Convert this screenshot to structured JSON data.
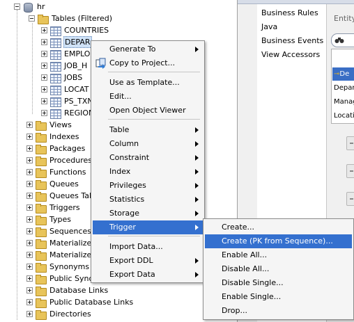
{
  "tree": {
    "root": "hr",
    "tables_folder": "Tables (Filtered)",
    "tables": [
      "COUNTRIES",
      "DEPAR",
      "EMPLO",
      "JOB_H",
      "JOBS",
      "LOCAT",
      "PS_TXN",
      "REGION"
    ],
    "folders": [
      "Views",
      "Indexes",
      "Packages",
      "Procedures",
      "Functions",
      "Queues",
      "Queues Tal",
      "Triggers",
      "Types",
      "Sequences",
      "Materialize",
      "Materialize",
      "Synonyms",
      "Public Syno",
      "Database Links",
      "Public Database Links",
      "Directories"
    ]
  },
  "right_panel": {
    "nav_items": [
      "Business Rules",
      "Java",
      "Business Events",
      "View Accessors"
    ],
    "entity_label": "Entity",
    "list_items": [
      "De",
      "Depart",
      "Manag",
      "Locatio"
    ]
  },
  "context_menu": {
    "items": [
      {
        "label": "Generate To",
        "submenu": true
      },
      {
        "label": "Copy to Project...",
        "icon": "copy-icon"
      },
      {
        "label": "Use as Template..."
      },
      {
        "label": "Edit..."
      },
      {
        "label": "Open Object Viewer"
      },
      {
        "label": "Table",
        "submenu": true
      },
      {
        "label": "Column",
        "submenu": true
      },
      {
        "label": "Constraint",
        "submenu": true
      },
      {
        "label": "Index",
        "submenu": true
      },
      {
        "label": "Privileges",
        "submenu": true
      },
      {
        "label": "Statistics",
        "submenu": true
      },
      {
        "label": "Storage",
        "submenu": true
      },
      {
        "label": "Trigger",
        "submenu": true,
        "active": true
      },
      {
        "label": "Import Data..."
      },
      {
        "label": "Export DDL",
        "submenu": true
      },
      {
        "label": "Export Data",
        "submenu": true
      }
    ]
  },
  "trigger_submenu": {
    "items": [
      "Create...",
      "Create (PK from Sequence)...",
      "Enable All...",
      "Disable All...",
      "Disable Single...",
      "Enable Single...",
      "Drop..."
    ],
    "active_index": 1
  },
  "colors": {
    "menu_highlight": "#3470cf",
    "selection": "#cfe2f7",
    "panel_bg": "#f0f0f0"
  }
}
